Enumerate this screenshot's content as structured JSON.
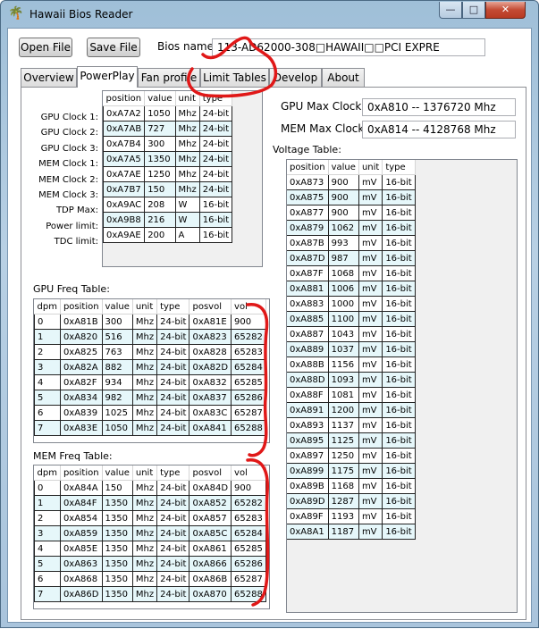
{
  "window": {
    "title": "Hawaii Bios Reader",
    "icon": "palm-tree-icon",
    "minimize": "—",
    "maximize": "□",
    "close": "✕"
  },
  "toolbar": {
    "open_label": "Open File",
    "save_label": "Save File",
    "bios_name_label": "Bios name:",
    "bios_name_value": "113-AD62000-308□HAWAII□□PCI  EXPRE"
  },
  "tabs": [
    "Overview",
    "PowerPlay",
    "Fan profile",
    "Limit Tables",
    "Develop",
    "About"
  ],
  "active_tab": "PowerPlay",
  "powerplay": {
    "headers": [
      "position",
      "value",
      "unit",
      "type"
    ],
    "rows": [
      {
        "label": "GPU Clock 1:",
        "cells": [
          "0xA7A2",
          "1050",
          "Mhz",
          "24-bit"
        ]
      },
      {
        "label": "GPU Clock 2:",
        "cells": [
          "0xA7AB",
          "727",
          "Mhz",
          "24-bit"
        ]
      },
      {
        "label": "GPU Clock 3:",
        "cells": [
          "0xA7B4",
          "300",
          "Mhz",
          "24-bit"
        ]
      },
      {
        "label": "MEM Clock 1:",
        "cells": [
          "0xA7A5",
          "1350",
          "Mhz",
          "24-bit"
        ]
      },
      {
        "label": "MEM Clock 2:",
        "cells": [
          "0xA7AE",
          "1250",
          "Mhz",
          "24-bit"
        ]
      },
      {
        "label": "MEM Clock 3:",
        "cells": [
          "0xA7B7",
          "150",
          "Mhz",
          "24-bit"
        ]
      },
      {
        "label": "TDP Max:",
        "cells": [
          "0xA9AC",
          "208",
          "W",
          "16-bit"
        ]
      },
      {
        "label": "Power limit:",
        "cells": [
          "0xA9B8",
          "216",
          "W",
          "16-bit"
        ]
      },
      {
        "label": "TDC limit:",
        "cells": [
          "0xA9AE",
          "200",
          "A",
          "16-bit"
        ]
      }
    ]
  },
  "max_clock": {
    "gpu_label": "GPU Max Clock:",
    "gpu_value": "0xA810 -- 1376720 Mhz",
    "mem_label": "MEM Max Clock:",
    "mem_value": "0xA814 -- 4128768 Mhz"
  },
  "voltage_table": {
    "title": "Voltage Table:",
    "headers": [
      "position",
      "value",
      "unit",
      "type"
    ],
    "rows": [
      [
        "0xA873",
        "900",
        "mV",
        "16-bit"
      ],
      [
        "0xA875",
        "900",
        "mV",
        "16-bit"
      ],
      [
        "0xA877",
        "900",
        "mV",
        "16-bit"
      ],
      [
        "0xA879",
        "1062",
        "mV",
        "16-bit"
      ],
      [
        "0xA87B",
        "993",
        "mV",
        "16-bit"
      ],
      [
        "0xA87D",
        "987",
        "mV",
        "16-bit"
      ],
      [
        "0xA87F",
        "1068",
        "mV",
        "16-bit"
      ],
      [
        "0xA881",
        "1006",
        "mV",
        "16-bit"
      ],
      [
        "0xA883",
        "1000",
        "mV",
        "16-bit"
      ],
      [
        "0xA885",
        "1100",
        "mV",
        "16-bit"
      ],
      [
        "0xA887",
        "1043",
        "mV",
        "16-bit"
      ],
      [
        "0xA889",
        "1037",
        "mV",
        "16-bit"
      ],
      [
        "0xA88B",
        "1156",
        "mV",
        "16-bit"
      ],
      [
        "0xA88D",
        "1093",
        "mV",
        "16-bit"
      ],
      [
        "0xA88F",
        "1081",
        "mV",
        "16-bit"
      ],
      [
        "0xA891",
        "1200",
        "mV",
        "16-bit"
      ],
      [
        "0xA893",
        "1137",
        "mV",
        "16-bit"
      ],
      [
        "0xA895",
        "1125",
        "mV",
        "16-bit"
      ],
      [
        "0xA897",
        "1250",
        "mV",
        "16-bit"
      ],
      [
        "0xA899",
        "1175",
        "mV",
        "16-bit"
      ],
      [
        "0xA89B",
        "1168",
        "mV",
        "16-bit"
      ],
      [
        "0xA89D",
        "1287",
        "mV",
        "16-bit"
      ],
      [
        "0xA89F",
        "1193",
        "mV",
        "16-bit"
      ],
      [
        "0xA8A1",
        "1187",
        "mV",
        "16-bit"
      ]
    ]
  },
  "gpu_freq_table": {
    "title": "GPU Freq Table:",
    "headers": [
      "dpm",
      "position",
      "value",
      "unit",
      "type",
      "posvol",
      "vol"
    ],
    "rows": [
      [
        "0",
        "0xA81B",
        "300",
        "Mhz",
        "24-bit",
        "0xA81E",
        "900"
      ],
      [
        "1",
        "0xA820",
        "516",
        "Mhz",
        "24-bit",
        "0xA823",
        "65282"
      ],
      [
        "2",
        "0xA825",
        "763",
        "Mhz",
        "24-bit",
        "0xA828",
        "65283"
      ],
      [
        "3",
        "0xA82A",
        "882",
        "Mhz",
        "24-bit",
        "0xA82D",
        "65284"
      ],
      [
        "4",
        "0xA82F",
        "934",
        "Mhz",
        "24-bit",
        "0xA832",
        "65285"
      ],
      [
        "5",
        "0xA834",
        "982",
        "Mhz",
        "24-bit",
        "0xA837",
        "65286"
      ],
      [
        "6",
        "0xA839",
        "1025",
        "Mhz",
        "24-bit",
        "0xA83C",
        "65287"
      ],
      [
        "7",
        "0xA83E",
        "1050",
        "Mhz",
        "24-bit",
        "0xA841",
        "65288"
      ]
    ]
  },
  "mem_freq_table": {
    "title": "MEM Freq Table:",
    "headers": [
      "dpm",
      "position",
      "value",
      "unit",
      "type",
      "posvol",
      "vol"
    ],
    "rows": [
      [
        "0",
        "0xA84A",
        "150",
        "Mhz",
        "24-bit",
        "0xA84D",
        "900"
      ],
      [
        "1",
        "0xA84F",
        "1350",
        "Mhz",
        "24-bit",
        "0xA852",
        "65282"
      ],
      [
        "2",
        "0xA854",
        "1350",
        "Mhz",
        "24-bit",
        "0xA857",
        "65283"
      ],
      [
        "3",
        "0xA859",
        "1350",
        "Mhz",
        "24-bit",
        "0xA85C",
        "65284"
      ],
      [
        "4",
        "0xA85E",
        "1350",
        "Mhz",
        "24-bit",
        "0xA861",
        "65285"
      ],
      [
        "5",
        "0xA863",
        "1350",
        "Mhz",
        "24-bit",
        "0xA866",
        "65286"
      ],
      [
        "6",
        "0xA868",
        "1350",
        "Mhz",
        "24-bit",
        "0xA86B",
        "65287"
      ],
      [
        "7",
        "0xA86D",
        "1350",
        "Mhz",
        "24-bit",
        "0xA870",
        "65288"
      ]
    ]
  },
  "colors": {
    "annotation": "#e01818",
    "row_alt": "#e6f7fa",
    "close_button": "#c44b34"
  }
}
